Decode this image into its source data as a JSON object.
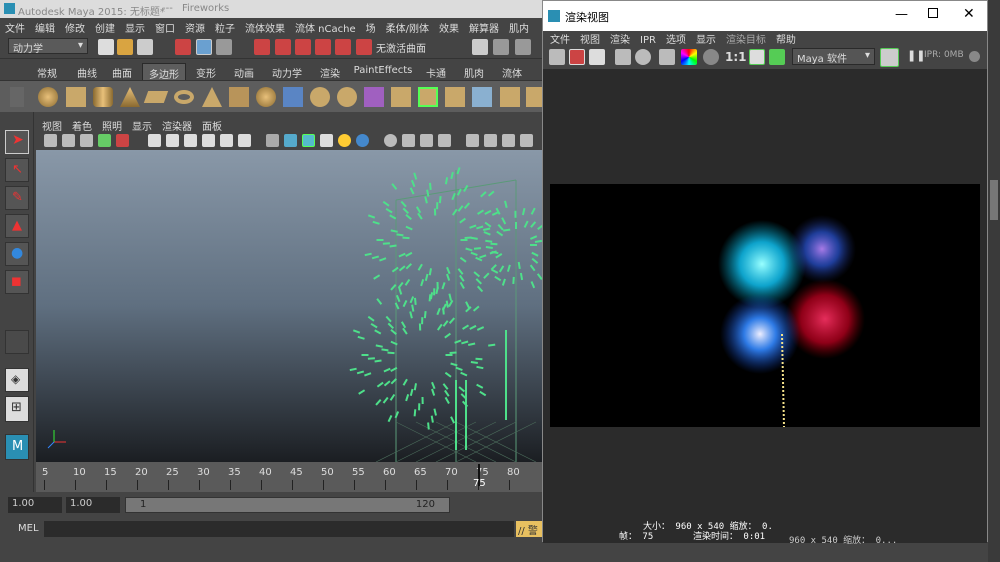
{
  "maya": {
    "title": "Autodesk Maya 2015: 无标题*",
    "title_dots": "---",
    "tab2": "Fireworks",
    "menus": [
      "文件",
      "编辑",
      "修改",
      "创建",
      "显示",
      "窗口",
      "资源",
      "粒子",
      "流体效果",
      "流体 nCache",
      "场",
      "柔体/刚体",
      "效果",
      "解算器",
      "肌内"
    ],
    "mode_dropdown": "动力学",
    "status_text": "无激活曲面",
    "shelf_tabs": [
      "常规",
      "曲线",
      "曲面",
      "多边形",
      "变形",
      "动画",
      "动力学",
      "渲染",
      "PaintEffects",
      "卡通",
      "肌肉",
      "流体"
    ],
    "active_shelf_tab": "多边形",
    "viewport_menus": [
      "视图",
      "着色",
      "照明",
      "显示",
      "渲染器",
      "面板"
    ],
    "timeline_ticks": [
      "5",
      "10",
      "15",
      "20",
      "25",
      "30",
      "35",
      "40",
      "45",
      "50",
      "55",
      "60",
      "65",
      "70",
      "75",
      "80"
    ],
    "current_frame": "75",
    "range_start": "1.00",
    "range_start2": "1.00",
    "range_slider_start": "1",
    "range_slider_end": "120",
    "cmd_label": "MEL",
    "cmd_right": "// 警"
  },
  "render_view": {
    "title": "渲染视图",
    "menus": [
      "文件",
      "视图",
      "渲染",
      "IPR",
      "选项",
      "显示",
      "渲染目标",
      "帮助"
    ],
    "ratio_label": "1:1",
    "renderer_dropdown": "Maya 软件",
    "ipr_label": "IPR: 0MB",
    "info_size": "大小： 960 x 540 缩放： 0.",
    "info_frame": "帧： 75",
    "info_time": "渲染时间： 0:01",
    "info_trail": "960 x 540 缩放： 0..."
  },
  "colors": {
    "active_tab": "#5d5d5d",
    "highlight": "#5bbcd6",
    "particles": "#4ee08a"
  }
}
